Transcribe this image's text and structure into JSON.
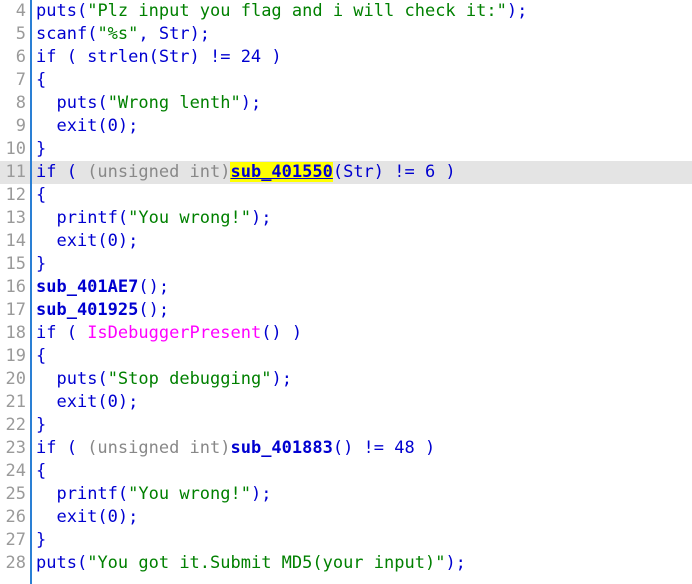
{
  "editor": {
    "name": "hex-rays-pseudocode-view",
    "first_line_number": 4,
    "selected_line_number": 11,
    "colors": {
      "background": "#ffffff",
      "gutter_text": "#9a9a9a",
      "gutter_rule": "#2a7fd4",
      "selection_row": "#e4e4e4",
      "keyword": "#0000d0",
      "string": "#008000",
      "cast": "#888888",
      "winapi": "#ff00ff",
      "highlight_background": "#ffff00"
    }
  },
  "lines": [
    {
      "number": "4",
      "selected": false,
      "tokens": [
        {
          "t": "puts",
          "c": "fn"
        },
        {
          "t": "(",
          "c": "kw"
        },
        {
          "t": "\"Plz input you flag and i will check it:\"",
          "c": "str"
        },
        {
          "t": ");",
          "c": "kw"
        }
      ]
    },
    {
      "number": "5",
      "selected": false,
      "tokens": [
        {
          "t": "scanf",
          "c": "fn"
        },
        {
          "t": "(",
          "c": "kw"
        },
        {
          "t": "\"%s\"",
          "c": "str"
        },
        {
          "t": ", Str);",
          "c": "kw"
        }
      ]
    },
    {
      "number": "6",
      "selected": false,
      "tokens": [
        {
          "t": "if ( strlen(Str) != 24 )",
          "c": "kw"
        }
      ]
    },
    {
      "number": "7",
      "selected": false,
      "tokens": [
        {
          "t": "{",
          "c": "kw"
        }
      ]
    },
    {
      "number": "8",
      "selected": false,
      "tokens": [
        {
          "t": "  ",
          "c": "kw"
        },
        {
          "t": "puts",
          "c": "fn"
        },
        {
          "t": "(",
          "c": "kw"
        },
        {
          "t": "\"Wrong lenth\"",
          "c": "str"
        },
        {
          "t": ");",
          "c": "kw"
        }
      ]
    },
    {
      "number": "9",
      "selected": false,
      "tokens": [
        {
          "t": "  exit(0);",
          "c": "kw"
        }
      ]
    },
    {
      "number": "10",
      "selected": false,
      "tokens": [
        {
          "t": "}",
          "c": "kw"
        }
      ]
    },
    {
      "number": "11",
      "selected": true,
      "tokens": [
        {
          "t": "if ( ",
          "c": "kw"
        },
        {
          "t": "(unsigned int)",
          "c": "cast"
        },
        {
          "t": "sub_401550",
          "c": "sub-hl"
        },
        {
          "t": "(Str) != 6 )",
          "c": "kw"
        }
      ]
    },
    {
      "number": "12",
      "selected": false,
      "tokens": [
        {
          "t": "{",
          "c": "kw"
        }
      ]
    },
    {
      "number": "13",
      "selected": false,
      "tokens": [
        {
          "t": "  ",
          "c": "kw"
        },
        {
          "t": "printf",
          "c": "fn"
        },
        {
          "t": "(",
          "c": "kw"
        },
        {
          "t": "\"You wrong!\"",
          "c": "str"
        },
        {
          "t": ");",
          "c": "kw"
        }
      ]
    },
    {
      "number": "14",
      "selected": false,
      "tokens": [
        {
          "t": "  exit(0);",
          "c": "kw"
        }
      ]
    },
    {
      "number": "15",
      "selected": false,
      "tokens": [
        {
          "t": "}",
          "c": "kw"
        }
      ]
    },
    {
      "number": "16",
      "selected": false,
      "tokens": [
        {
          "t": "sub_401AE7",
          "c": "sub"
        },
        {
          "t": "();",
          "c": "kw"
        }
      ]
    },
    {
      "number": "17",
      "selected": false,
      "tokens": [
        {
          "t": "sub_401925",
          "c": "sub"
        },
        {
          "t": "();",
          "c": "kw"
        }
      ]
    },
    {
      "number": "18",
      "selected": false,
      "tokens": [
        {
          "t": "if ( ",
          "c": "kw"
        },
        {
          "t": "IsDebuggerPresent",
          "c": "api"
        },
        {
          "t": "() )",
          "c": "kw"
        }
      ]
    },
    {
      "number": "19",
      "selected": false,
      "tokens": [
        {
          "t": "{",
          "c": "kw"
        }
      ]
    },
    {
      "number": "20",
      "selected": false,
      "tokens": [
        {
          "t": "  ",
          "c": "kw"
        },
        {
          "t": "puts",
          "c": "fn"
        },
        {
          "t": "(",
          "c": "kw"
        },
        {
          "t": "\"Stop debugging\"",
          "c": "str"
        },
        {
          "t": ");",
          "c": "kw"
        }
      ]
    },
    {
      "number": "21",
      "selected": false,
      "tokens": [
        {
          "t": "  exit(0);",
          "c": "kw"
        }
      ]
    },
    {
      "number": "22",
      "selected": false,
      "tokens": [
        {
          "t": "}",
          "c": "kw"
        }
      ]
    },
    {
      "number": "23",
      "selected": false,
      "tokens": [
        {
          "t": "if ( ",
          "c": "kw"
        },
        {
          "t": "(unsigned int)",
          "c": "cast"
        },
        {
          "t": "sub_401883",
          "c": "sub"
        },
        {
          "t": "() != 48 )",
          "c": "kw"
        }
      ]
    },
    {
      "number": "24",
      "selected": false,
      "tokens": [
        {
          "t": "{",
          "c": "kw"
        }
      ]
    },
    {
      "number": "25",
      "selected": false,
      "tokens": [
        {
          "t": "  ",
          "c": "kw"
        },
        {
          "t": "printf",
          "c": "fn"
        },
        {
          "t": "(",
          "c": "kw"
        },
        {
          "t": "\"You wrong!\"",
          "c": "str"
        },
        {
          "t": ");",
          "c": "kw"
        }
      ]
    },
    {
      "number": "26",
      "selected": false,
      "tokens": [
        {
          "t": "  exit(0);",
          "c": "kw"
        }
      ]
    },
    {
      "number": "27",
      "selected": false,
      "tokens": [
        {
          "t": "}",
          "c": "kw"
        }
      ]
    },
    {
      "number": "28",
      "selected": false,
      "tokens": [
        {
          "t": "puts",
          "c": "fn"
        },
        {
          "t": "(",
          "c": "kw"
        },
        {
          "t": "\"You got it.Submit MD5(your input)\"",
          "c": "str"
        },
        {
          "t": ");",
          "c": "kw"
        }
      ]
    }
  ]
}
